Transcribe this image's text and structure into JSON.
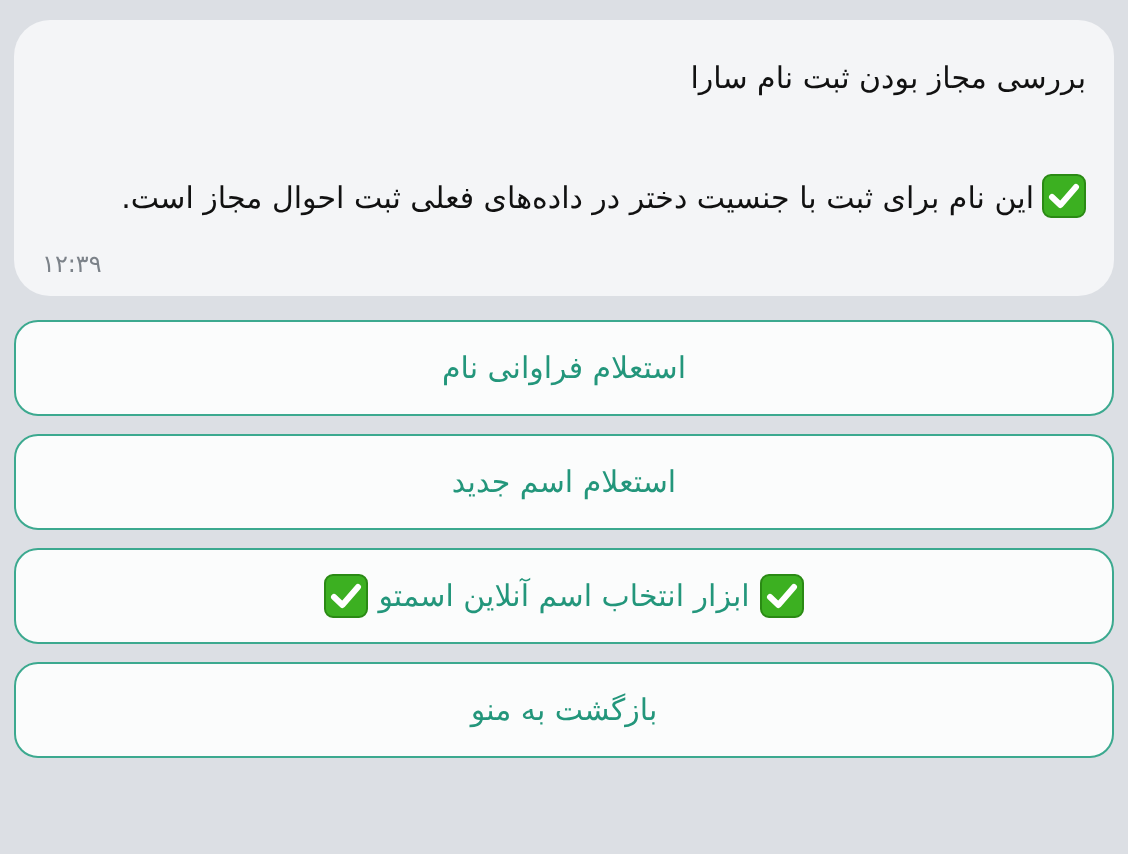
{
  "message": {
    "title": "بررسی مجاز بودن ثبت نام سارا",
    "body": {
      "check_mark": true,
      "text": "این نام برای ثبت با جنسیت دختر در داده‌های فعلی ثبت احوال مجاز است."
    },
    "time": "۱۲:۳۹"
  },
  "buttons": [
    {
      "label": "استعلام فراوانی نام",
      "check_marks": false
    },
    {
      "label": "استعلام اسم جدید",
      "check_marks": false
    },
    {
      "label": "ابزار انتخاب اسم آنلاین اسمتو",
      "check_marks": true
    },
    {
      "label": "بازگشت به منو",
      "check_marks": false
    }
  ]
}
